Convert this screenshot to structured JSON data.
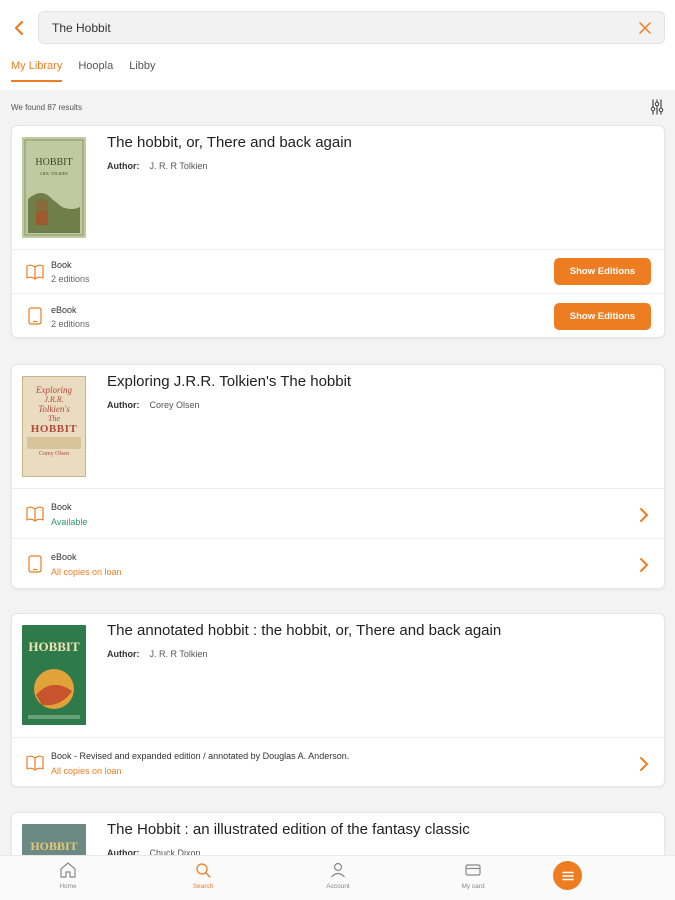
{
  "header": {
    "search_value": "The Hobbit",
    "back_icon": "chevron-left-icon",
    "clear_icon": "close-icon"
  },
  "tabs": [
    {
      "label": "My Library",
      "active": true
    },
    {
      "label": "Hoopla",
      "active": false
    },
    {
      "label": "Libby",
      "active": false
    }
  ],
  "results": {
    "count_text": "We found 87 results",
    "filter_icon": "sliders-icon"
  },
  "cards": [
    {
      "title": "The hobbit, or, There and back again",
      "author_label": "Author:",
      "author": "J. R. R Tolkien",
      "formats": [
        {
          "name": "Book",
          "sub": "2 editions",
          "button": "Show Editions"
        },
        {
          "name": "eBook",
          "sub": "2 editions",
          "button": "Show Editions"
        }
      ]
    },
    {
      "title": "Exploring J.R.R. Tolkien's The hobbit",
      "author_label": "Author:",
      "author": "Corey Olsen",
      "cover_text": {
        "line1": "Exploring",
        "line2": "J.R.R.",
        "line3": "Tolkien's",
        "line4": "The",
        "line5": "HOBBIT",
        "line6": "Corey Olsen"
      },
      "formats": [
        {
          "name": "Book",
          "sub": "Available"
        },
        {
          "name": "eBook",
          "sub": "All copies on loan"
        }
      ]
    },
    {
      "title": "The annotated hobbit : the hobbit, or, There and back again",
      "author_label": "Author:",
      "author": "J. R. R Tolkien",
      "cover_text": {
        "line1": "HOBBIT"
      },
      "formats": [
        {
          "name": "Book - Revised and expanded edition / annotated by Douglas A. Anderson.",
          "sub": "All copies on loan"
        }
      ]
    },
    {
      "title": "The Hobbit : an illustrated edition of the fantasy classic",
      "author_label": "Author:",
      "author": "Chuck Dixon"
    }
  ],
  "bottom_nav": [
    {
      "label": "Home",
      "icon": "home-icon",
      "active": false
    },
    {
      "label": "Search",
      "icon": "search-icon",
      "active": true
    },
    {
      "label": "Account",
      "icon": "account-icon",
      "active": false
    },
    {
      "label": "My card",
      "icon": "card-icon",
      "active": false
    }
  ],
  "menu_icon": "menu-icon",
  "colors": {
    "accent": "#ee7d22",
    "available": "#2e9a6a"
  }
}
